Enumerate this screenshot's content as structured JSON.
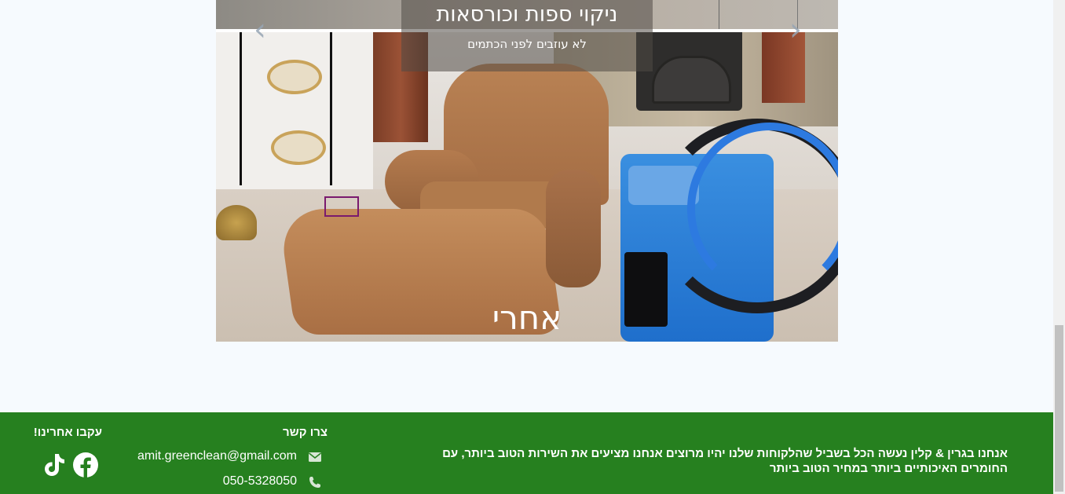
{
  "carousel": {
    "slide_title": "ניקוי ספות וכורסאות",
    "slide_subtitle": "לא עוזבים לפני הכתמים",
    "after_label": "אחרי",
    "prev_arrow": "‹",
    "next_arrow": "›"
  },
  "footer": {
    "about_text": "אנחנו בגרין & קלין נעשה הכל בשביל שהלקוחות שלנו יהיו מרוצים אנחנו מציעים את השירות הטוב ביותר, עם החומרים האיכותיים ביותר במחיר הטוב ביותר",
    "contact": {
      "title": "צרו קשר",
      "email": "amit.greenclean@gmail.com",
      "email_icon": "envelope-icon",
      "phone": "050-5328050",
      "phone_icon": "phone-icon"
    },
    "social": {
      "title": "עקבו אחרינו!",
      "facebook_icon": "facebook-icon",
      "tiktok_icon": "tiktok-icon"
    }
  },
  "colors": {
    "footer_bg": "#26801f",
    "page_bg": "#f6fafe",
    "focus_outline": "#7a1a6e"
  }
}
